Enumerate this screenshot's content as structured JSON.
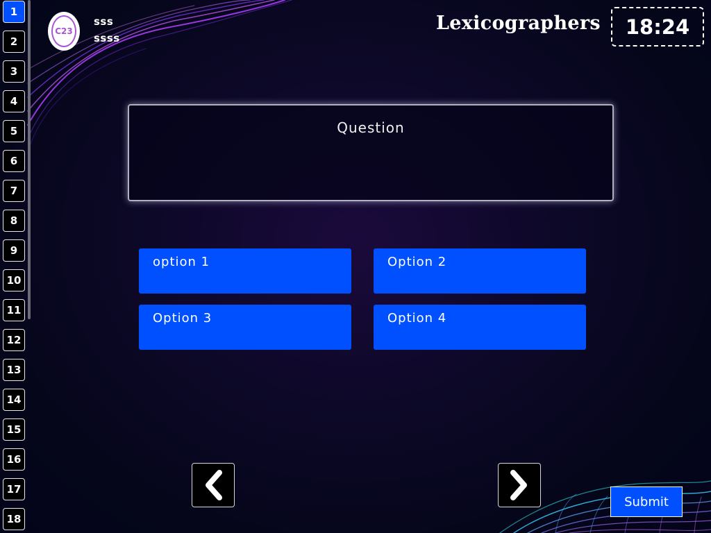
{
  "sidebar": {
    "numbers": [
      "1",
      "2",
      "3",
      "4",
      "5",
      "6",
      "7",
      "8",
      "9",
      "10",
      "11",
      "12",
      "13",
      "14",
      "15",
      "16",
      "17",
      "18"
    ],
    "active_index": 0
  },
  "user": {
    "avatar_text": "C23",
    "name": "sss",
    "id": "ssss"
  },
  "header": {
    "title": "Lexicographers",
    "timer": "18:24"
  },
  "question": {
    "text": "Question"
  },
  "options": [
    "option 1",
    "Option 2",
    "Option 3",
    "Option 4"
  ],
  "nav": {
    "prev_icon": "chevron-left-icon",
    "next_icon": "chevron-right-icon"
  },
  "submit_label": "Submit",
  "colors": {
    "accent": "#0050ff",
    "background": "#05061a",
    "avatar_ring": "#a855d8"
  }
}
